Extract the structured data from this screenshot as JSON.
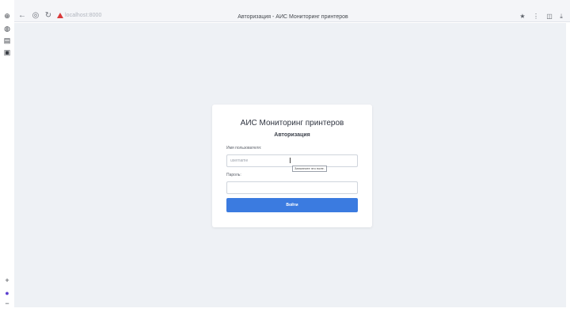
{
  "browser": {
    "url": "localhost:8000",
    "page_title": "Авторизация - АИС Мониторинг принтеров"
  },
  "login": {
    "title": "АИС Мониторинг принтеров",
    "subtitle": "Авторизация",
    "username_label": "Имя пользователя:",
    "username_placeholder": "username",
    "username_tooltip": "Заполните это поле.",
    "password_label": "Пароль:",
    "password_placeholder": "",
    "submit_label": "Войти"
  },
  "colors": {
    "accent": "#3b7be0",
    "background": "#eef1f5",
    "card": "#ffffff"
  }
}
